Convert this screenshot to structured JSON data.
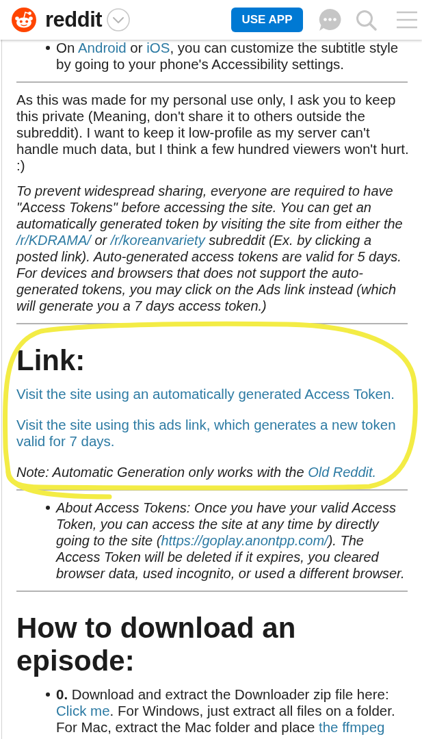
{
  "header": {
    "logo_text": "reddit",
    "button": "USE APP"
  },
  "content": [
    {
      "kind": "bullet",
      "italic": false,
      "parts": [
        {
          "kind": "text",
          "text": "On "
        },
        {
          "kind": "link",
          "text": "Android"
        },
        {
          "kind": "text",
          "text": " or "
        },
        {
          "kind": "link",
          "text": "iOS"
        },
        {
          "kind": "text",
          "text": ", you can customize the subtitle style by going to your phone's Accessibility settings."
        }
      ]
    },
    {
      "kind": "rule"
    },
    {
      "kind": "paragraph",
      "italic": false,
      "parts": [
        {
          "kind": "text",
          "text": "As this was made for my personal use only, I ask you to keep this private (Meaning, don't share it to others outside the subreddit). I want to keep it low-profile as my server can't handle much data, but I think a few hundred viewers won't hurt. :)"
        }
      ]
    },
    {
      "kind": "paragraph",
      "italic": true,
      "parts": [
        {
          "kind": "text",
          "text": "To prevent widespread sharing, everyone are required to have \"Access Tokens\" before accessing the site. You can get an automatically generated token by visiting the site from either the "
        },
        {
          "kind": "link",
          "text": "/r/KDRAMA/"
        },
        {
          "kind": "text",
          "text": " or "
        },
        {
          "kind": "link",
          "text": "/r/koreanvariety"
        },
        {
          "kind": "text",
          "text": " subreddit (Ex. by clicking a posted link). Auto-generated access tokens are valid for 5 days. For devices and browsers that does not support the auto-generated tokens, you may click on the Ads link instead (which will generate you a 7 days access token.)"
        }
      ]
    },
    {
      "kind": "rule"
    },
    {
      "kind": "heading",
      "text": "Link:"
    },
    {
      "kind": "paragraph",
      "italic": false,
      "parts": [
        {
          "kind": "link",
          "text": "Visit the site using an automatically generated Access Token."
        }
      ]
    },
    {
      "kind": "paragraph",
      "italic": false,
      "parts": [
        {
          "kind": "link",
          "text": "Visit the site using this ads link, which generates a new token valid for 7 days."
        }
      ]
    },
    {
      "kind": "paragraph",
      "italic": true,
      "parts": [
        {
          "kind": "text",
          "text": "Note: Automatic Generation only works with the "
        },
        {
          "kind": "link",
          "text": "Old Reddit."
        }
      ]
    },
    {
      "kind": "rule"
    },
    {
      "kind": "bullet",
      "italic": true,
      "parts": [
        {
          "kind": "text",
          "text": "About Access Tokens: Once you have your valid Access Token, you can access the site at any time by directly going to the site ("
        },
        {
          "kind": "link",
          "text": "https://goplay.anontpp.com/"
        },
        {
          "kind": "text",
          "text": "). The Access Token will be deleted if it expires, you cleared browser data, used incognito, or used a different browser."
        }
      ]
    },
    {
      "kind": "rule"
    },
    {
      "kind": "heading",
      "text": "How to download an episode:"
    },
    {
      "kind": "bullet",
      "italic": false,
      "parts": [
        {
          "kind": "text",
          "text": "**0.** Download and extract the Downloader zip file here: "
        },
        {
          "kind": "link",
          "text": "Click me"
        },
        {
          "kind": "text",
          "text": ". For Windows, just extract all files on a folder. For Mac, extract the Mac folder and place "
        },
        {
          "kind": "link",
          "text": "the ffmpeg"
        }
      ]
    }
  ]
}
